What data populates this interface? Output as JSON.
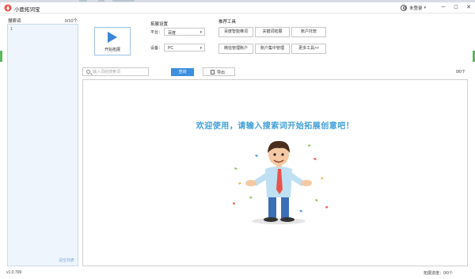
{
  "app": {
    "title": "小鹿拓词宝",
    "user_name": "未登录",
    "window_controls": [
      "─",
      "☐",
      "✕"
    ]
  },
  "keywords_panel": {
    "title": "搜索词",
    "count": "0/10个",
    "first_line_number": "1",
    "clear_label": "清空列表"
  },
  "start_button": {
    "label": "开始拓展",
    "icon": "play-icon"
  },
  "settings": {
    "title": "拓展设置",
    "platform_label": "平台：",
    "platform_value": "百度",
    "device_label": "设备：",
    "device_value": "PC"
  },
  "tools": {
    "title": "推荐工具",
    "buttons": [
      "百度智能推词",
      "关键词拓展",
      "账户托管",
      "微信管理账户",
      "账户集中管理",
      "更多工具>>"
    ]
  },
  "search": {
    "placeholder": "输入词组搜索词",
    "query_label": "查询",
    "export_label": "导出",
    "result_count": "0/0个"
  },
  "welcome": {
    "message": "欢迎使用，请输入搜索词开始拓展创意吧！"
  },
  "footer": {
    "version": "v1.0.709",
    "progress": "拓展进度：0/0个"
  },
  "colors": {
    "accent": "#3c8fde",
    "welcome": "#3f9fd9",
    "keyword_panel_bg": "#eef5fc",
    "side_tab": "#5cb85c"
  }
}
